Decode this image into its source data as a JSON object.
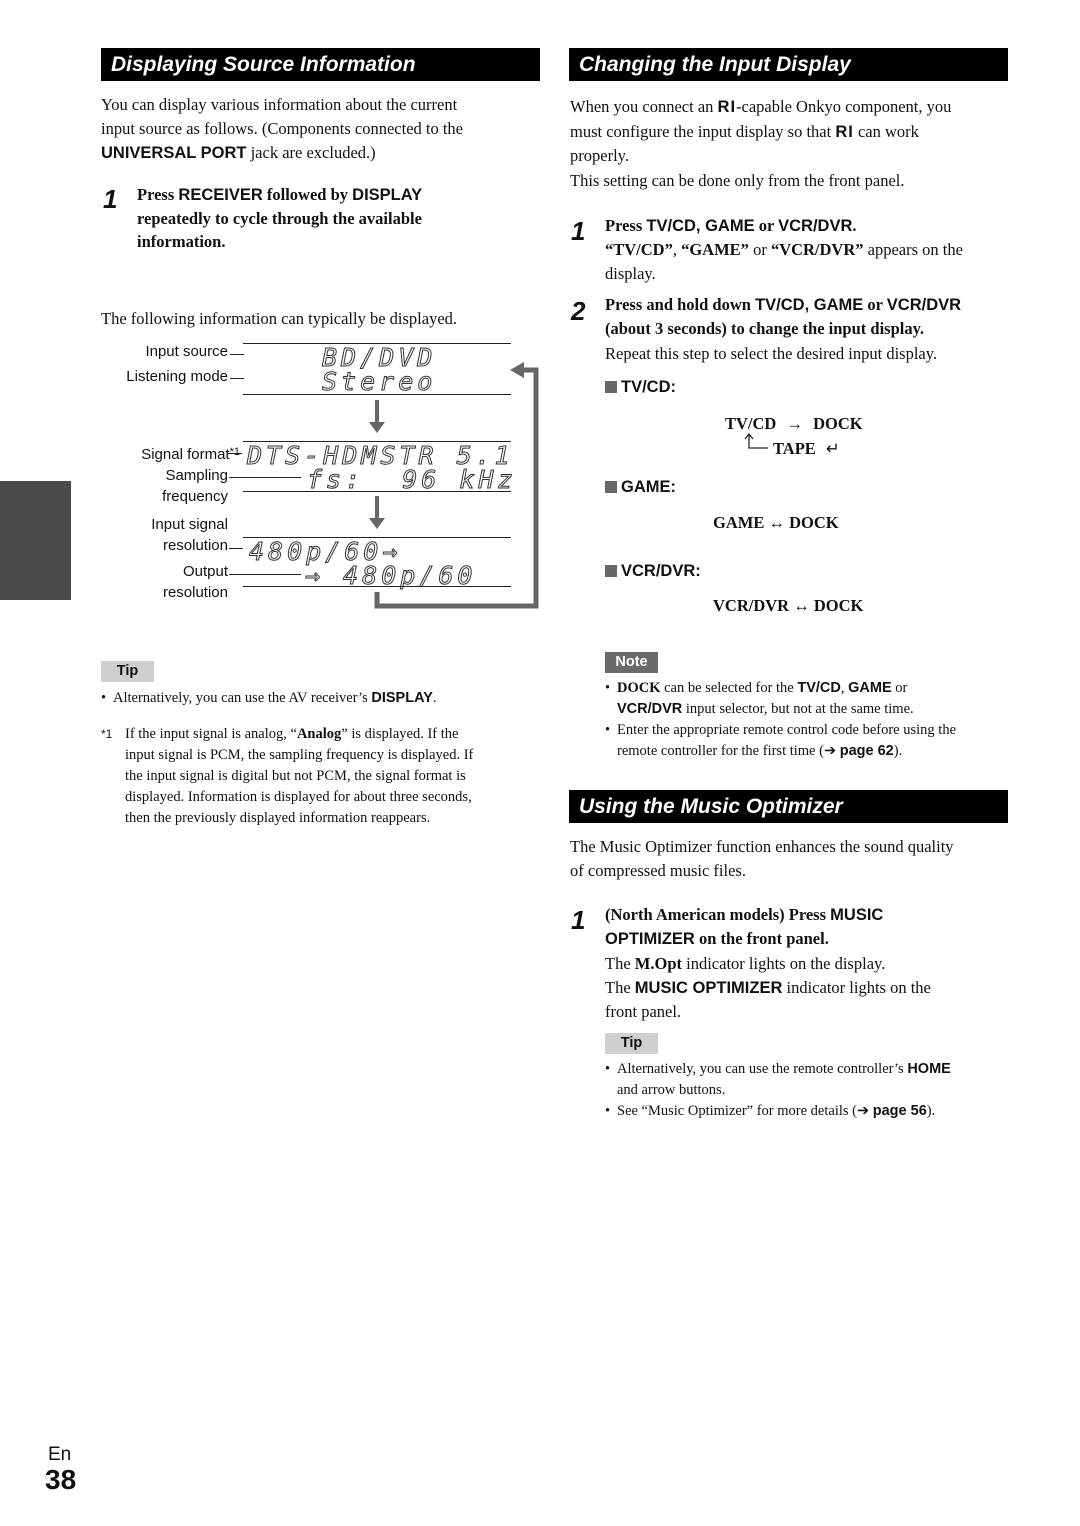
{
  "left": {
    "section_title": "Displaying Source Information",
    "intro": {
      "line1": "You can display various information about the current",
      "line2": "input source as follows. (Components connected to the",
      "line3_bold": "UNIVERSAL PORT",
      "line3_rest": " jack are excluded.)"
    },
    "step1": {
      "number": "1",
      "parts": [
        "Press ",
        "RECEIVER",
        " followed by ",
        "DISPLAY"
      ],
      "line2": "repeatedly to cycle through the available",
      "line3": "information."
    },
    "following_text": "The following information can typically be displayed.",
    "diagram": {
      "labels": {
        "input_source": "Input source",
        "listening_mode": "Listening mode",
        "signal_format": "Signal format",
        "signal_format_note": "*1",
        "sampling_1": "Sampling",
        "sampling_2": "frequency",
        "input_res_1": "Input signal",
        "input_res_2": "resolution",
        "output_res_1": "Output",
        "output_res_2": "resolution"
      },
      "screens": [
        {
          "line1": "BD/DVD",
          "line2": "Stereo"
        },
        {
          "line1": "DTS-HDMSTR 5.1",
          "line2": "fs:  96 kHz"
        },
        {
          "line1": "480p/60→",
          "line2": "→ 480p/60"
        }
      ]
    },
    "tip": {
      "label": "Tip",
      "bullet": "•",
      "text_pre": "Alternatively, you can use the AV receiver’s ",
      "text_bold": "DISPLAY",
      "text_post": "."
    },
    "footnote": {
      "marker": "*1",
      "pre": "If the input signal is analog, “",
      "bold": "Analog",
      "post": "” is displayed. If the",
      "line2": "input signal is PCM, the sampling frequency is displayed. If",
      "line3": "the input signal is digital but not PCM, the signal format is",
      "line4": "displayed. Information is displayed for about three seconds,",
      "line5": "then the previously displayed information reappears."
    }
  },
  "right": {
    "section_title": "Changing the Input Display",
    "intro": {
      "line1_pre": "When you connect an ",
      "ri_icon": "RI",
      "line1_post": "-capable Onkyo component, you",
      "line2_pre": "must configure the input display so that ",
      "line2_post": " can work",
      "line3": "properly.",
      "line4": "This setting can be done only from the front panel."
    },
    "step1": {
      "number": "1",
      "pre": "Press ",
      "bold": "TV/CD, GAME",
      "mid": " or ",
      "bold2": "VCR/DVR",
      "post": ".",
      "desc_q1": "“TV/CD”",
      "desc_sep1": ", ",
      "desc_q2": "“GAME”",
      "desc_sep2": " or ",
      "desc_q3": "“VCR/DVR”",
      "desc_post": " appears on the",
      "desc_line2": "display."
    },
    "step2": {
      "number": "2",
      "pre": "Press and hold down ",
      "bold": "TV/CD, GAME",
      "mid": " or ",
      "bold2": "VCR/DVR",
      "line2": "(about 3 seconds) to change the input display.",
      "desc": "Repeat this step to select the desired input display."
    },
    "groups": [
      {
        "heading": "TV/CD:",
        "seq_a": "TV/CD",
        "arrow": "→",
        "seq_b": "DOCK",
        "seq_c": "TAPE",
        "return_arrow": "↵"
      },
      {
        "heading": "GAME:",
        "sequence": "GAME ↔ DOCK"
      },
      {
        "heading": "VCR/DVR:",
        "sequence": "VCR/DVR ↔ DOCK"
      }
    ],
    "note": {
      "label": "Note",
      "items": [
        {
          "bold_lead": "DOCK",
          "pre": " can be selected for the ",
          "b1": "TV/CD",
          "sep": ", ",
          "b2": "GAME",
          "post": " or",
          "line2_bold": "VCR/DVR",
          "line2_rest": " input selector, but not at the same time."
        },
        {
          "line1": "Enter the appropriate remote control code before using the",
          "line2_pre": "remote controller for the first time (",
          "arrow": "➔",
          "link": "page 62",
          "line2_post": ")."
        }
      ]
    },
    "music": {
      "section_title": "Using the Music Optimizer",
      "intro1": "The Music Optimizer function enhances the sound quality",
      "intro2": "of compressed music files.",
      "step1": {
        "number": "1",
        "pre": "(North American models) Press ",
        "bold": "MUSIC",
        "line2_bold": "OPTIMIZER",
        "line2_rest": " on the front panel.",
        "desc1_pre": "The ",
        "desc1_bold": "M.Opt",
        "desc1_post": " indicator lights on the display.",
        "desc2_pre": "The ",
        "desc2_bold": "MUSIC OPTIMIZER",
        "desc2_post": " indicator lights on the",
        "desc3": "front panel."
      },
      "tip": {
        "label": "Tip",
        "items": [
          {
            "pre": "Alternatively, you can use the remote controller’s ",
            "bold": "HOME",
            "line2": "and arrow buttons."
          },
          {
            "pre": "See “Music Optimizer” for more details (",
            "arrow": "➔",
            "link": "page 56",
            "post": ")."
          }
        ]
      }
    }
  },
  "footer": {
    "lang": "En",
    "page_number": "38"
  },
  "colors": {
    "header_bg": "#000000",
    "side_tab": "#4a4a4a",
    "tip_bg": "#cfcfcf",
    "note_bg": "#6a6a6a",
    "arrow_gray": "#666666"
  }
}
